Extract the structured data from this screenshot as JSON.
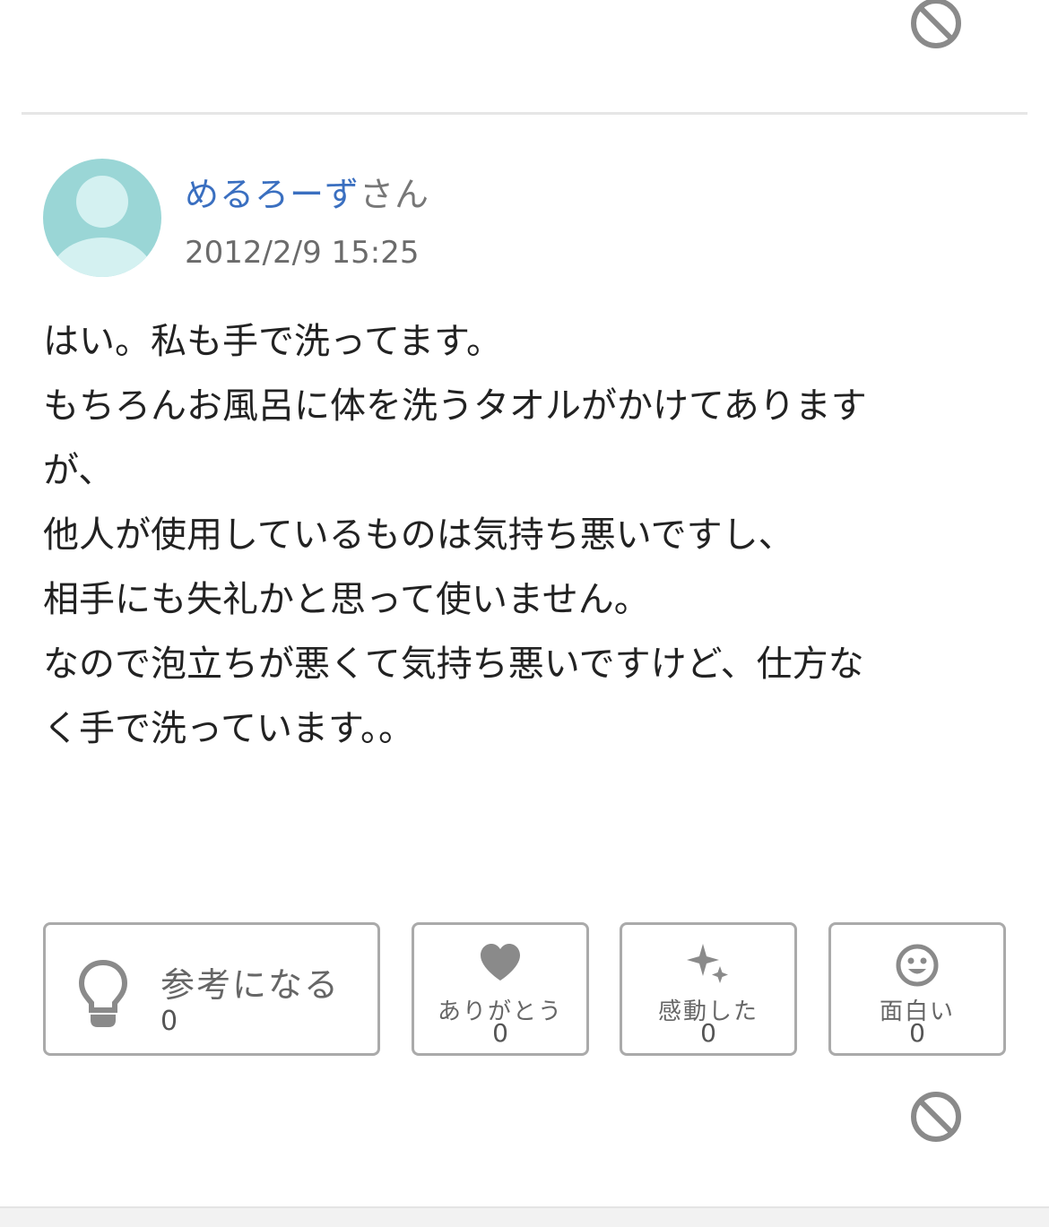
{
  "answer": {
    "author_name": "めるろーず",
    "author_suffix": "さん",
    "date": "2012/2/9 15:25",
    "body": [
      "はい。私も手で洗ってます。",
      "",
      "もちろんお風呂に体を洗うタオルがかけてあります\nが、\n他人が使用しているものは気持ち悪いですし、\n相手にも失礼かと思って使いません。",
      "",
      "なので泡立ちが悪くて気持ち悪いですけど、仕方な\nく手で洗っています。。"
    ]
  },
  "reactions": {
    "helpful": {
      "label": "参考になる",
      "count": "0"
    },
    "thanks": {
      "label": "ありがとう",
      "count": "0"
    },
    "moved": {
      "label": "感動した",
      "count": "0"
    },
    "funny": {
      "label": "面白い",
      "count": "0"
    }
  },
  "icons": {
    "block": "block-icon",
    "lightbulb": "lightbulb-icon",
    "heart": "heart-icon",
    "sparkle": "sparkle-icon",
    "smile": "smile-icon",
    "avatar": "avatar-icon"
  },
  "colors": {
    "author_link": "#3a6fc0",
    "avatar_bg": "#9ad6d6",
    "avatar_fg": "#d4f1f1",
    "icon_gray": "#8a8a8a",
    "border_gray": "#aaaaaa"
  }
}
